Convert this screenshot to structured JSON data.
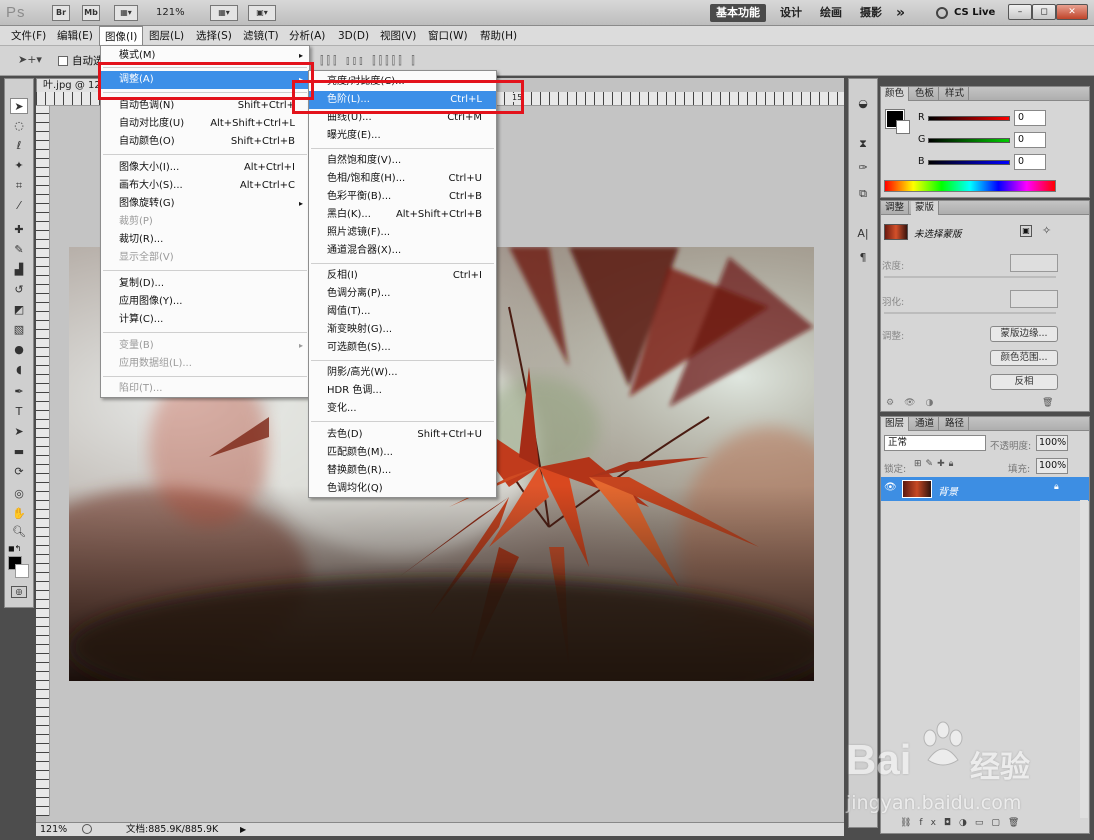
{
  "titlebar": {
    "logo": "Ps",
    "br": "Br",
    "mb": "Mb",
    "zoom": "121%",
    "workspaces": [
      "基本功能",
      "设计",
      "绘画",
      "摄影"
    ],
    "more": "»",
    "cslive": "CS Live",
    "win": [
      "–",
      "◻",
      "✕"
    ]
  },
  "menubar": [
    "文件(F)",
    "编辑(E)",
    "图像(I)",
    "图层(L)",
    "选择(S)",
    "滤镜(T)",
    "分析(A)",
    "3D(D)",
    "视图(V)",
    "窗口(W)",
    "帮助(H)"
  ],
  "options": {
    "auto_label": "自动选",
    "ruler_num": "15"
  },
  "doc": {
    "tab": "叶.jpg @ 12"
  },
  "image_menu": {
    "items": [
      {
        "label": "模式(M)",
        "arrow": "▸"
      },
      {
        "label": "调整(A)",
        "arrow": "▸"
      },
      {
        "label": "自动色调(N)",
        "sc": "Shift+Ctrl+"
      },
      {
        "label": "自动对比度(U)",
        "sc": "Alt+Shift+Ctrl+L"
      },
      {
        "label": "自动颜色(O)",
        "sc": "Shift+Ctrl+B"
      },
      {
        "label": "图像大小(I)...",
        "sc": "Alt+Ctrl+I"
      },
      {
        "label": "画布大小(S)...",
        "sc": "Alt+Ctrl+C"
      },
      {
        "label": "图像旋转(G)",
        "arrow": "▸"
      },
      {
        "label": "裁剪(P)"
      },
      {
        "label": "裁切(R)..."
      },
      {
        "label": "显示全部(V)"
      },
      {
        "label": "复制(D)..."
      },
      {
        "label": "应用图像(Y)..."
      },
      {
        "label": "计算(C)..."
      },
      {
        "label": "变量(B)",
        "arrow": "▸"
      },
      {
        "label": "应用数据组(L)..."
      },
      {
        "label": "陷印(T)..."
      }
    ]
  },
  "adjust_menu": {
    "items": [
      {
        "label": "亮度/对比度(C)..."
      },
      {
        "label": "色阶(L)...",
        "sc": "Ctrl+L"
      },
      {
        "label": "曲线(U)...",
        "sc": "Ctrl+M"
      },
      {
        "label": "曝光度(E)..."
      },
      {
        "label": "自然饱和度(V)..."
      },
      {
        "label": "色相/饱和度(H)...",
        "sc": "Ctrl+U"
      },
      {
        "label": "色彩平衡(B)...",
        "sc": "Ctrl+B"
      },
      {
        "label": "黑白(K)...",
        "sc": "Alt+Shift+Ctrl+B"
      },
      {
        "label": "照片滤镜(F)..."
      },
      {
        "label": "通道混合器(X)..."
      },
      {
        "label": "反相(I)",
        "sc": "Ctrl+I"
      },
      {
        "label": "色调分离(P)..."
      },
      {
        "label": "阈值(T)..."
      },
      {
        "label": "渐变映射(G)..."
      },
      {
        "label": "可选颜色(S)..."
      },
      {
        "label": "阴影/高光(W)..."
      },
      {
        "label": "HDR 色调..."
      },
      {
        "label": "变化..."
      },
      {
        "label": "去色(D)",
        "sc": "Shift+Ctrl+U"
      },
      {
        "label": "匹配颜色(M)..."
      },
      {
        "label": "替换颜色(R)..."
      },
      {
        "label": "色调均化(Q)"
      }
    ]
  },
  "color_panel": {
    "tabs": [
      "颜色",
      "色板",
      "样式"
    ],
    "r_label": "R",
    "g_label": "G",
    "b_label": "B",
    "r": "0",
    "g": "0",
    "b": "0"
  },
  "mask_panel": {
    "tabs": [
      "调整",
      "蒙版"
    ],
    "status": "未选择蒙版",
    "density": "浓度:",
    "feather": "羽化:",
    "refine": "调整:",
    "btn_edge": "蒙版边缘...",
    "btn_range": "颜色范围...",
    "btn_invert": "反相"
  },
  "layers_panel": {
    "tabs": [
      "图层",
      "通道",
      "路径"
    ],
    "blend": "正常",
    "opacity_label": "不透明度:",
    "opacity": "100%",
    "lock_label": "锁定:",
    "fill_label": "填充:",
    "fill": "100%",
    "layer_name": "背景"
  },
  "status": {
    "zoom": "121%",
    "doc": "文档:885.9K/885.9K"
  },
  "watermark": {
    "brand": "Bai",
    "brand2": "经验",
    "url": "jingyan.baidu.com"
  },
  "colors": {
    "highlight": "#3c8fe8",
    "callout": "#e3121b"
  }
}
